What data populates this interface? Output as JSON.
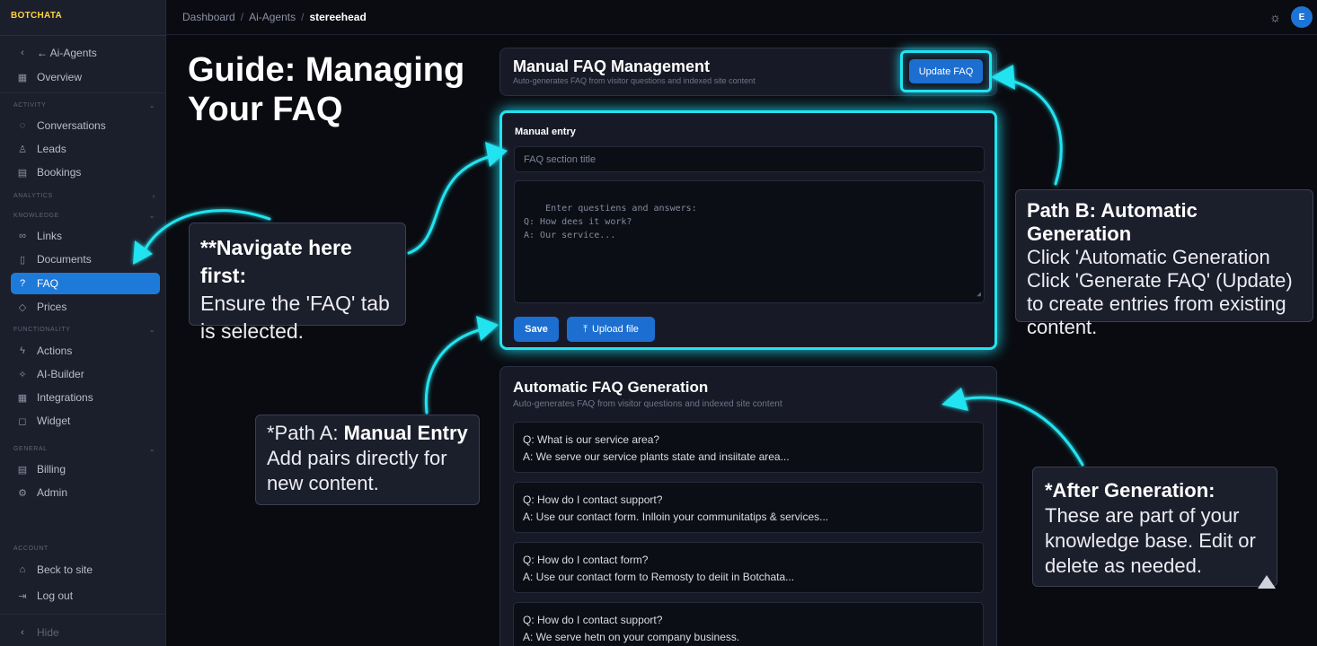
{
  "sidebar": {
    "brand": "BOTCHATA",
    "back_label": "← Ai-Agents",
    "overview": "Overview",
    "sections": {
      "activity": "ACTIVITY",
      "analytics": "ANALYTICS",
      "knowledge": "KNOWLEDGE",
      "functionality": "FUNCTIONALITY",
      "general": "GENERAL",
      "account": "ACCOUNT"
    },
    "items": {
      "conversations": "Conversations",
      "leads": "Leads",
      "bookings": "Bookings",
      "links": "Links",
      "documents": "Documents",
      "faq": "FAQ",
      "prices": "Prices",
      "actions": "Actions",
      "ai_builder": "AI-Builder",
      "integrations": "Integrations",
      "widget": "Widget",
      "billing": "Billing",
      "admin": "Admin",
      "back_to_site": "Beck to site",
      "log_out": "Log out",
      "hide": "Hide"
    }
  },
  "topbar": {
    "crumb1": "Dashboard",
    "crumb2": "Ai-Agents",
    "crumb3": "stereehead",
    "sep": "/",
    "avatar": "E"
  },
  "guide": {
    "title": "Guide: Managing Your  FAQ"
  },
  "header_card": {
    "title": "Manual FAQ Management",
    "subtitle": "Auto-generates FAQ from visitor questions and indexed site content",
    "update_button": "Update FAQ"
  },
  "manual": {
    "label": "Manual entry",
    "title_placeholder": "FAQ section title",
    "textarea_placeholder": "Enter questiens and answers:\nQ: How dees it work?\nA: Our service...",
    "save_button": "Save",
    "upload_button": "Upload file"
  },
  "auto": {
    "title": "Automatic FAQ Generation",
    "subtitle": "Auto-generates FAQ from visitor questions and indexed site content",
    "items": [
      {
        "q": "Q: What is our service area?",
        "a": "A: We serve our service plants state and insiitate area..."
      },
      {
        "q": "Q: How do I contact support?",
        "a": "A: Use our contact form. Inlloin your communitatips & services..."
      },
      {
        "q": "Q: How do I contact form?",
        "a": "A: Use our contact form to Remosty to deiit in Botchata..."
      },
      {
        "q": "Q: How do I contact support?",
        "a": "A: We serve hetn on your company business."
      }
    ]
  },
  "callouts": {
    "nav_bold": "**Navigate here first:",
    "nav_text": "Ensure the 'FAQ' tab is selected.",
    "a_prefix": "*Path A: ",
    "a_bold": "Manual Entry",
    "a_text": "Add pairs directly for new content.",
    "b_bold": "Path B: Automatic Generation",
    "b_line1": "Click 'Automatic Generation",
    "b_line2": "Click 'Generate FAQ' (Update)",
    "b_line3": "to create entries from existing content.",
    "after_bold": "*After Generation:",
    "after_text": "These are part of your knowledge base. Edit or delete as needed."
  },
  "colors": {
    "accent": "#1c6fd1",
    "glow": "#22e3f0",
    "brand": "#ffd23f"
  }
}
